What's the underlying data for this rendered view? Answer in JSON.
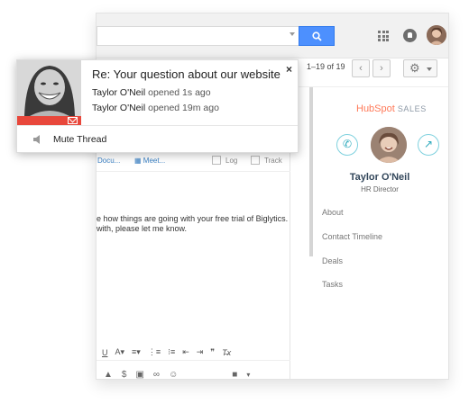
{
  "gmail": {
    "pagination": "1–19 of 19",
    "nav_prev": "‹",
    "nav_next": "›",
    "gear": "⚙"
  },
  "compose": {
    "tool_docs": "Docu...",
    "tool_meet": "Meet...",
    "log_label": "Log",
    "track_label": "Track",
    "body_line1": "e how things are going with your free trial of Biglytics.",
    "body_line2": " with, please let me know."
  },
  "hubspot": {
    "logo": "HubSpot",
    "logo_suffix": "SALES",
    "contact_name": "Taylor O'Neil",
    "contact_title": "HR Director",
    "links": [
      "About",
      "Contact Timeline",
      "Deals",
      "Tasks"
    ]
  },
  "notification": {
    "title": "Re: Your question about our website",
    "close": "×",
    "events": [
      {
        "name": "Taylor O'Neil",
        "text": " opened 1s ago"
      },
      {
        "name": "Taylor O'Neil",
        "text": " opened 19m ago"
      }
    ],
    "mute_label": "Mute Thread"
  },
  "colors": {
    "accent_blue": "#4d90fe",
    "hubspot_orange": "#ff7a59",
    "teal": "#2ca9bc",
    "notif_red": "#e8473b"
  },
  "icons": [
    "search-icon",
    "apps-grid-icon",
    "notifications-icon",
    "gear-icon",
    "phone-icon",
    "arrow-icon",
    "close-icon",
    "mail-icon",
    "speaker-icon"
  ]
}
